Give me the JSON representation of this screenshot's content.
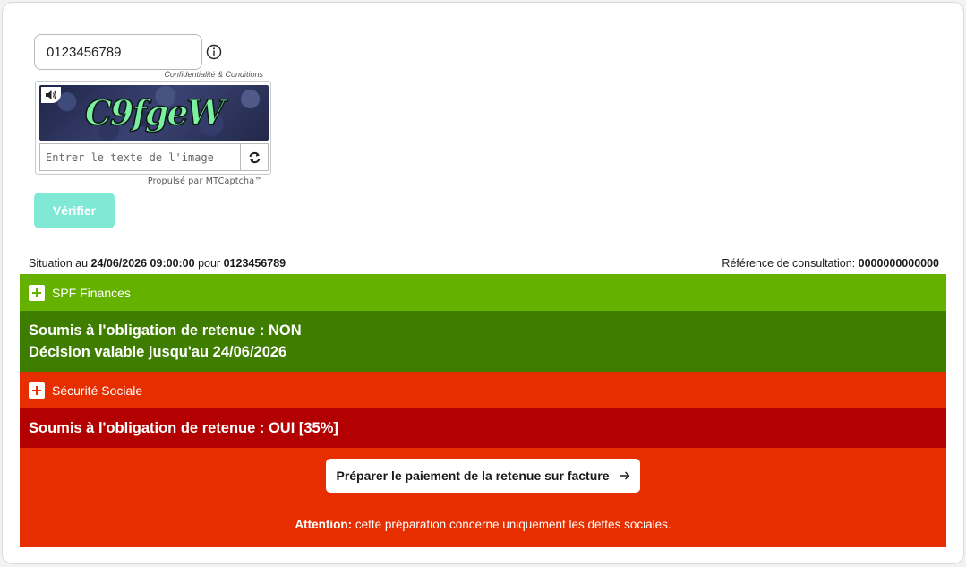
{
  "form": {
    "number_value": "0123456789",
    "conditions_link": "Confidentialité & Conditions",
    "captcha": {
      "image_text": "C9fgeW",
      "input_placeholder": "Entrer le texte de l'image",
      "powered_by": "Propulsé par MTCaptcha™"
    },
    "verify_label": "Vérifier"
  },
  "status": {
    "prefix": "Situation au",
    "datetime": "24/06/2026 09:00:00",
    "for_word": "pour",
    "number": "0123456789",
    "reference_label": "Référence de consultation:",
    "reference_value": "0000000000000"
  },
  "spf": {
    "header": "SPF Finances",
    "line1": "Soumis à l'obligation de retenue : NON",
    "line2": "Décision valable jusqu'au 24/06/2026"
  },
  "social": {
    "header": "Sécurité Sociale",
    "line1": "Soumis à l'obligation de retenue : OUI [35%]",
    "prepare_button": "Préparer le paiement de la retenue sur facture",
    "attention_label": "Attention:",
    "attention_text": " cette préparation concerne uniquement les dettes sociales."
  },
  "colors": {
    "spf_header": "#65b100",
    "spf_body": "#3f7d00",
    "social_header": "#e62e00",
    "social_body": "#b30000",
    "verify_button": "#7fe9d6"
  },
  "icons": [
    "info-icon",
    "speaker-icon",
    "refresh-icon",
    "plus-icon",
    "arrow-right-icon"
  ]
}
